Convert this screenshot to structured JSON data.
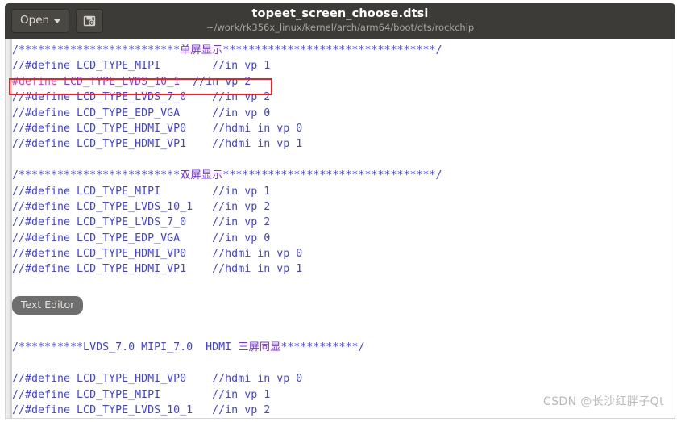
{
  "window": {
    "title": "topeet_screen_choose.dtsi",
    "path": "~/work/rk356x_linux/kernel/arch/arm64/boot/dts/rockchip"
  },
  "toolbar": {
    "open_label": "Open",
    "open_caret_icon": "chevron-down-icon",
    "save_icon": "save-icon"
  },
  "tooltip": {
    "label": "Text Editor"
  },
  "watermark": {
    "text": "CSDN @长沙红胖子Qt"
  },
  "colors": {
    "titlebar_bg": "#3c3b37",
    "editor_bg": "#ffffff",
    "comment": "#4040ee",
    "cjk_banner": "#7b2ff7",
    "preprocessor": "#d838c8",
    "macro_name": "#8f36e0",
    "highlight_box": "#ff1a1a",
    "tooltip_bg": "#6e6e6e",
    "watermark": "#b9b9b9"
  },
  "code": {
    "lines": [
      {
        "id": "banner-single-screen",
        "spans": [
          {
            "cls": "t-comment",
            "text": "/*************************"
          },
          {
            "cls": "t-cjk",
            "text": "单屏显示"
          },
          {
            "cls": "t-comment",
            "text": "*********************************/"
          }
        ]
      },
      {
        "id": "single-mipi",
        "spans": [
          {
            "cls": "t-comment",
            "text": "//#define LCD_TYPE_MIPI        //in vp 1"
          }
        ]
      },
      {
        "id": "single-lvds-10-1-active",
        "spans": [
          {
            "cls": "t-pre",
            "text": "#define "
          },
          {
            "cls": "t-macro",
            "text": "LCD_TYPE_LVDS_10_1"
          },
          {
            "cls": "t-comment",
            "text": "  //in vp 2"
          }
        ]
      },
      {
        "id": "single-lvds-7-0",
        "spans": [
          {
            "cls": "t-comment",
            "text": "//#define LCD_TYPE_LVDS_7_0    //in vp 2"
          }
        ]
      },
      {
        "id": "single-edp-vga",
        "spans": [
          {
            "cls": "t-comment",
            "text": "//#define LCD_TYPE_EDP_VGA     //in vp 0"
          }
        ]
      },
      {
        "id": "single-hdmi-vp0",
        "spans": [
          {
            "cls": "t-comment",
            "text": "//#define LCD_TYPE_HDMI_VP0    //hdmi in vp 0"
          }
        ]
      },
      {
        "id": "single-hdmi-vp1",
        "spans": [
          {
            "cls": "t-comment",
            "text": "//#define LCD_TYPE_HDMI_VP1    //hdmi in vp 1"
          }
        ]
      },
      {
        "id": "blank-1",
        "spans": [
          {
            "cls": "t-comment",
            "text": " "
          }
        ]
      },
      {
        "id": "banner-dual-screen",
        "spans": [
          {
            "cls": "t-comment",
            "text": "/*************************"
          },
          {
            "cls": "t-cjk",
            "text": "双屏显示"
          },
          {
            "cls": "t-comment",
            "text": "*********************************/"
          }
        ]
      },
      {
        "id": "dual-mipi",
        "spans": [
          {
            "cls": "t-comment",
            "text": "//#define LCD_TYPE_MIPI        //in vp 1"
          }
        ]
      },
      {
        "id": "dual-lvds-10-1",
        "spans": [
          {
            "cls": "t-comment",
            "text": "//#define LCD_TYPE_LVDS_10_1   //in vp 2"
          }
        ]
      },
      {
        "id": "dual-lvds-7-0",
        "spans": [
          {
            "cls": "t-comment",
            "text": "//#define LCD_TYPE_LVDS_7_0    //in vp 2"
          }
        ]
      },
      {
        "id": "dual-edp-vga",
        "spans": [
          {
            "cls": "t-comment",
            "text": "//#define LCD_TYPE_EDP_VGA     //in vp 0"
          }
        ]
      },
      {
        "id": "dual-hdmi-vp0",
        "spans": [
          {
            "cls": "t-comment",
            "text": "//#define LCD_TYPE_HDMI_VP0    //hdmi in vp 0"
          }
        ]
      },
      {
        "id": "dual-hdmi-vp1",
        "spans": [
          {
            "cls": "t-comment",
            "text": "//#define LCD_TYPE_HDMI_VP1    //hdmi in vp 1"
          }
        ]
      },
      {
        "id": "blank-2",
        "spans": [
          {
            "cls": "t-comment",
            "text": " "
          }
        ]
      },
      {
        "id": "blank-3",
        "spans": [
          {
            "cls": "t-comment",
            "text": " "
          }
        ]
      },
      {
        "id": "blank-4",
        "spans": [
          {
            "cls": "t-comment",
            "text": " "
          }
        ]
      },
      {
        "id": "blank-5",
        "spans": [
          {
            "cls": "t-comment",
            "text": " "
          }
        ]
      },
      {
        "id": "banner-triple-screen",
        "spans": [
          {
            "cls": "t-comment",
            "text": "/**********LVDS_7.0 MIPI_7.0  HDMI "
          },
          {
            "cls": "t-cjk",
            "text": "三屏同显"
          },
          {
            "cls": "t-comment",
            "text": "************/"
          }
        ]
      },
      {
        "id": "blank-6",
        "spans": [
          {
            "cls": "t-comment",
            "text": " "
          }
        ]
      },
      {
        "id": "triple-hdmi-vp0",
        "spans": [
          {
            "cls": "t-comment",
            "text": "//#define LCD_TYPE_HDMI_VP0    //hdmi in vp 0"
          }
        ]
      },
      {
        "id": "triple-mipi",
        "spans": [
          {
            "cls": "t-comment",
            "text": "//#define LCD_TYPE_MIPI        //in vp 1"
          }
        ]
      },
      {
        "id": "triple-lvds-10-1",
        "spans": [
          {
            "cls": "t-comment",
            "text": "//#define LCD_TYPE_LVDS_10_1   //in vp 2"
          }
        ]
      }
    ]
  }
}
